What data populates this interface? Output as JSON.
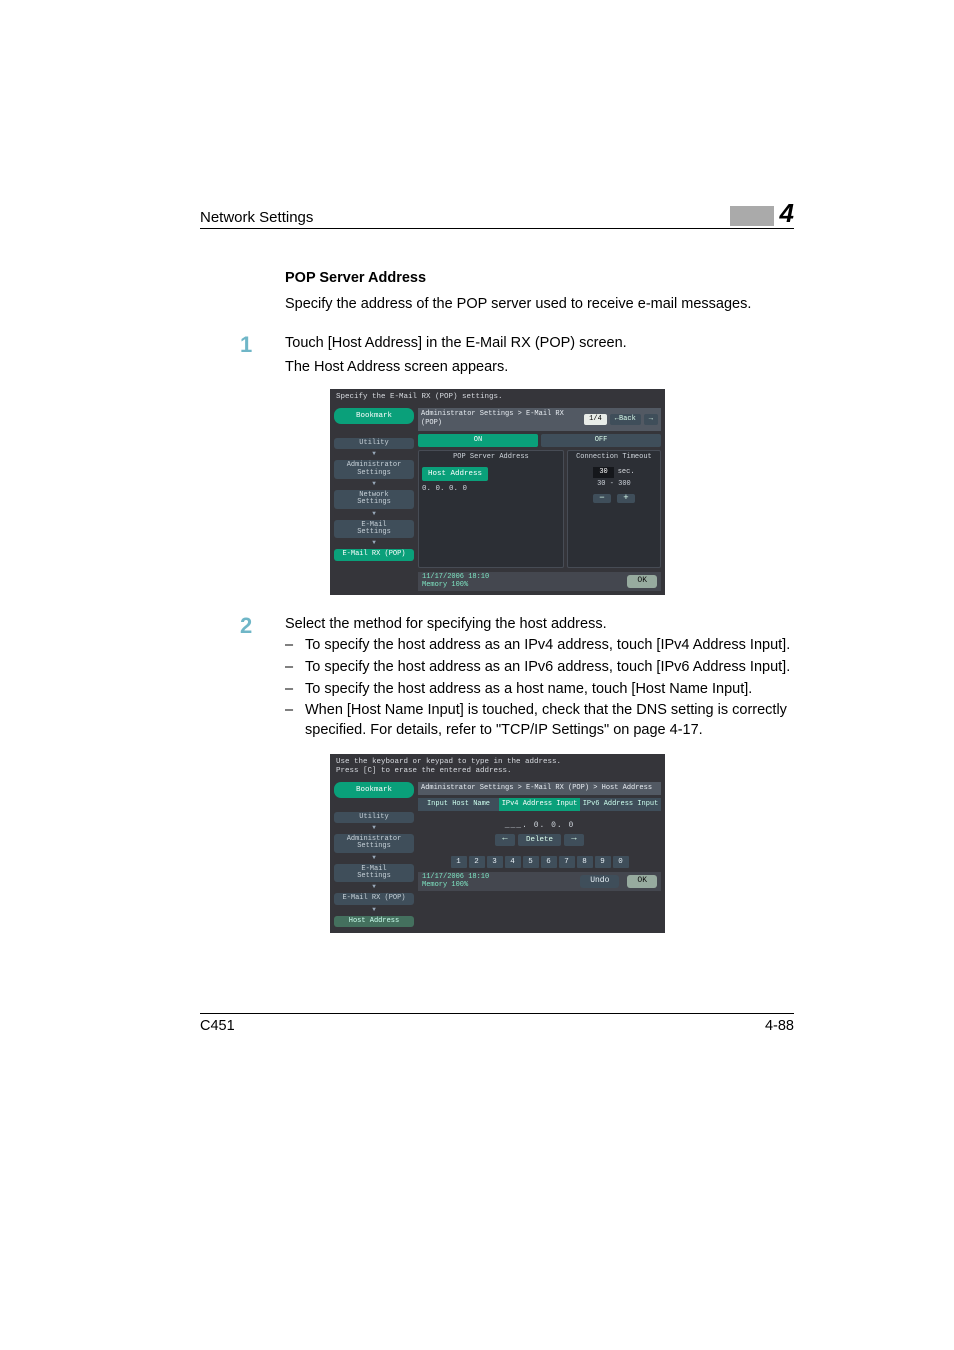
{
  "header": {
    "section": "Network Settings",
    "chapter": "4"
  },
  "content": {
    "title": "POP Server Address",
    "desc": "Specify the address of the POP server used to receive e-mail messages.",
    "step1": {
      "num": "1",
      "text": "Touch [Host Address] in the E-Mail RX (POP) screen.",
      "sub": "The Host Address screen appears."
    },
    "step2": {
      "num": "2",
      "text": "Select the method for specifying the host address.",
      "bullets": [
        "To specify the host address as an IPv4 address, touch [IPv4 Address Input].",
        "To specify the host address as an IPv6 address, touch [IPv6 Address Input].",
        "To specify the host address as a host name, touch [Host Name Input].",
        "When [Host Name Input] is touched, check that the DNS setting is correctly specified. For details, refer to \"TCP/IP Settings\" on page 4-17."
      ]
    }
  },
  "panel1": {
    "top_msg": "Specify the E-Mail RX (POP) settings.",
    "bookmark": "Bookmark",
    "side": [
      "Utility",
      "Administrator\nSettings",
      "Network\nSettings",
      "E-Mail\nSettings",
      "E-Mail RX (POP)"
    ],
    "breadcrumb": "Administrator Settings > E-Mail RX (POP)",
    "page": "1/4",
    "back": "←Back",
    "fwd": "→",
    "on": "ON",
    "off": "OFF",
    "left_title": "POP Server Address",
    "host_btn": "Host Address",
    "host_val": "0. 0. 0. 0",
    "right_title": "Connection Timeout",
    "ct_val": "30",
    "ct_unit": "sec.",
    "ct_range": "30   -   300",
    "minus": "−",
    "plus": "+",
    "ts_l1": "11/17/2006   18:10",
    "ts_l2": "Memory        100%",
    "ok": "OK"
  },
  "panel2": {
    "top_l1": "Use the keyboard or keypad to type in the address.",
    "top_l2": "Press [C] to erase the entered address.",
    "bookmark": "Bookmark",
    "side": [
      "Utility",
      "Administrator\nSettings",
      "E-Mail\nSettings",
      "E-Mail RX (POP)",
      "Host Address"
    ],
    "breadcrumb": "Administrator Settings > E-Mail RX (POP) > Host Address",
    "tabs": [
      "Input Host Name",
      "IPv4 Address Input",
      "IPv6 Address Input"
    ],
    "ip_disp": "___.   0.   0.   0",
    "left": "←",
    "delete": "Delete",
    "right": "→",
    "keys": [
      "1",
      "2",
      "3",
      "4",
      "5",
      "6",
      "7",
      "8",
      "9",
      "0"
    ],
    "ts_l1": "11/17/2006   18:10",
    "ts_l2": "Memory        100%",
    "undo": "Undo",
    "ok": "OK"
  },
  "footer": {
    "left": "C451",
    "right": "4-88"
  }
}
